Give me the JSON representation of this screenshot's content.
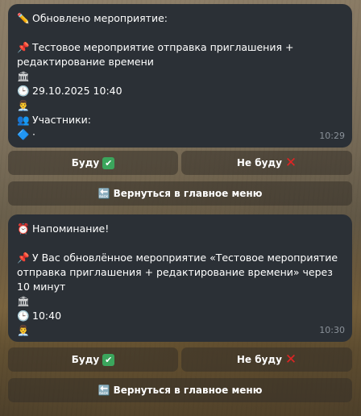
{
  "messages": [
    {
      "lines": [
        {
          "icon": "✏️",
          "icon_name": "pencil-icon",
          "text": "Обновлено мероприятие:"
        },
        {
          "icon": "",
          "icon_name": "",
          "text": ""
        },
        {
          "icon": "📌",
          "icon_name": "pushpin-icon",
          "text": "Тестовое мероприятие отправка приглашения + редактирование времени"
        },
        {
          "icon": "🏛",
          "icon_name": "building-icon",
          "text": ""
        },
        {
          "icon": "🕒",
          "icon_name": "clock-icon",
          "text": "29.10.2025 10:40"
        },
        {
          "icon": "👨‍💼",
          "icon_name": "person-icon",
          "text": ""
        },
        {
          "icon": "👥",
          "icon_name": "participants-icon",
          "text": "Участники:"
        },
        {
          "icon": "🔷",
          "icon_name": "diamond-icon",
          "text": "·"
        }
      ],
      "time": "10:29",
      "buttons": {
        "yes": "Буду",
        "no": "Не буду",
        "back": "Вернуться в главное меню"
      }
    },
    {
      "lines": [
        {
          "icon": "⏰",
          "icon_name": "alarm-clock-icon",
          "text": "Напоминание!"
        },
        {
          "icon": "",
          "icon_name": "",
          "text": ""
        },
        {
          "icon": "📌",
          "icon_name": "pushpin-icon",
          "text": "У Вас обновлённое мероприятие «Тестовое мероприятие отправка приглашения + редактирование времени» через 10 минут"
        },
        {
          "icon": "🏛",
          "icon_name": "building-icon",
          "text": ""
        },
        {
          "icon": "🕒",
          "icon_name": "clock-icon",
          "text": "10:40"
        },
        {
          "icon": "👨‍💼",
          "icon_name": "person-icon",
          "text": ""
        }
      ],
      "time": "10:30",
      "buttons": {
        "yes": "Буду",
        "no": "Не буду",
        "back": "Вернуться в главное меню"
      }
    }
  ],
  "colors": {
    "bubble": "#2b3036",
    "button": "#343028",
    "check": "#3ba55c",
    "cross": "#e02424"
  }
}
